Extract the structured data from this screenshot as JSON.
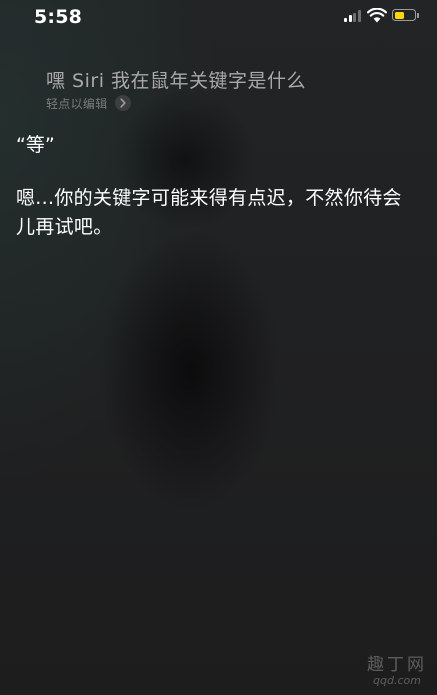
{
  "status_bar": {
    "time": "5:58",
    "signal_bars": 4,
    "signal_bars_active": 2,
    "battery_level": 0.5,
    "battery_color": "#ffd60a"
  },
  "siri": {
    "query": "嘿 Siri 我在鼠年关键字是什么",
    "edit_hint": "轻点以编辑",
    "edit_icon": "chevron-right-icon",
    "reply_short": "“等”",
    "reply_long": "嗯...你的关键字可能来得有点迟，不然你待会儿再试吧。"
  },
  "watermark": {
    "name": "趣丁网",
    "url": "qqd.com"
  }
}
